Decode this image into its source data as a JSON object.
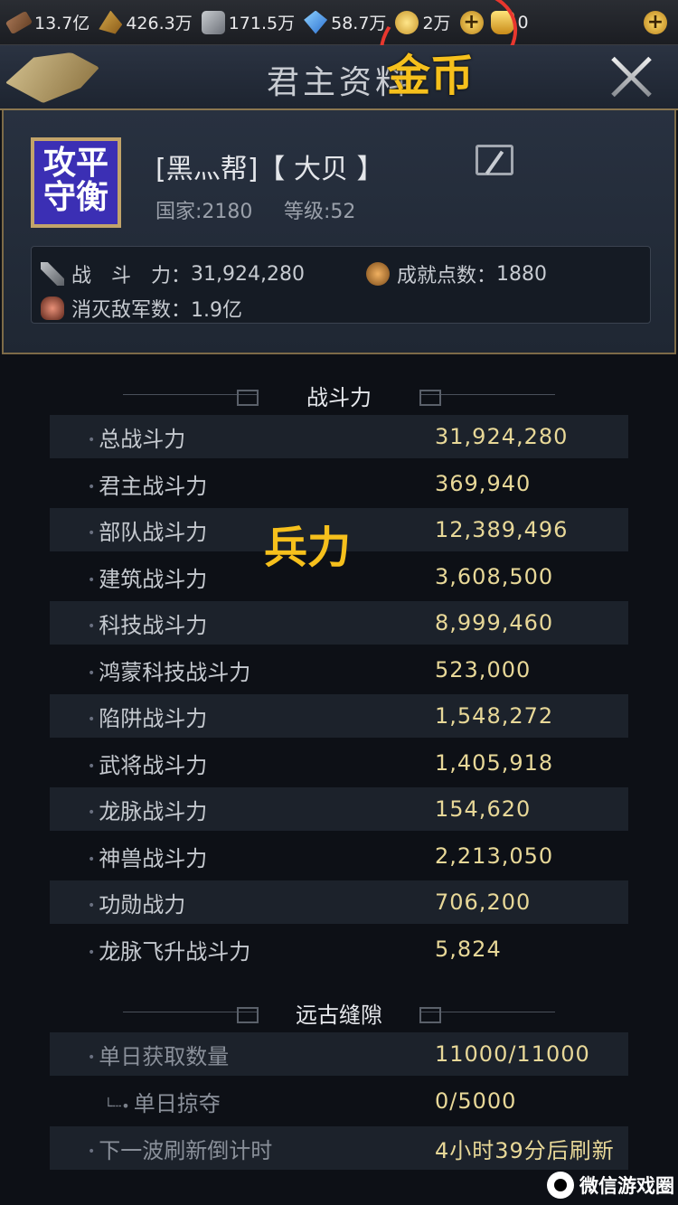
{
  "topbar": {
    "resources": [
      {
        "icon": "wood-icon",
        "value": "13.7亿"
      },
      {
        "icon": "food-icon",
        "value": "426.3万"
      },
      {
        "icon": "stone-icon",
        "value": "171.5万"
      },
      {
        "icon": "gem-icon",
        "value": "58.7万"
      },
      {
        "icon": "coin-icon",
        "value": "2万"
      }
    ],
    "ingot": {
      "icon": "ingot-icon",
      "value": "0"
    },
    "plus_symbol": "+"
  },
  "annotations": {
    "gold": "金币",
    "troops": "兵力"
  },
  "header": {
    "title": "君主资料"
  },
  "profile": {
    "avatar_text": "攻平守衡",
    "name": "[黑灬帮]【 大贝 】",
    "country": "国家:2180",
    "level": "等级:52",
    "combat_label": "战　斗　力：",
    "combat_value": "31,924,280",
    "achievement_label": "成就点数：",
    "achievement_value": "1880",
    "kills_label": "消灭敌军数：",
    "kills_value": "1.9亿"
  },
  "power_section": {
    "title": "战斗力",
    "rows": [
      {
        "label": "总战斗力",
        "value": "31,924,280"
      },
      {
        "label": "君主战斗力",
        "value": "369,940"
      },
      {
        "label": "部队战斗力",
        "value": "12,389,496"
      },
      {
        "label": "建筑战斗力",
        "value": "3,608,500"
      },
      {
        "label": "科技战斗力",
        "value": "8,999,460"
      },
      {
        "label": "鸿蒙科技战斗力",
        "value": "523,000"
      },
      {
        "label": "陷阱战斗力",
        "value": "1,548,272"
      },
      {
        "label": "武将战斗力",
        "value": "1,405,918"
      },
      {
        "label": "龙脉战斗力",
        "value": "154,620"
      },
      {
        "label": "神兽战斗力",
        "value": "2,213,050"
      },
      {
        "label": "功勋战力",
        "value": "706,200"
      },
      {
        "label": "龙脉飞升战斗力",
        "value": "5,824"
      }
    ]
  },
  "rift_section": {
    "title": "远古缝隙",
    "rows": [
      {
        "label": "单日获取数量",
        "value": "11000/11000"
      },
      {
        "label": "单日掠夺",
        "value": "0/5000"
      },
      {
        "label": "下一波刷新倒计时",
        "value": "4小时39分后刷新"
      }
    ]
  },
  "watermark": "微信游戏圈"
}
